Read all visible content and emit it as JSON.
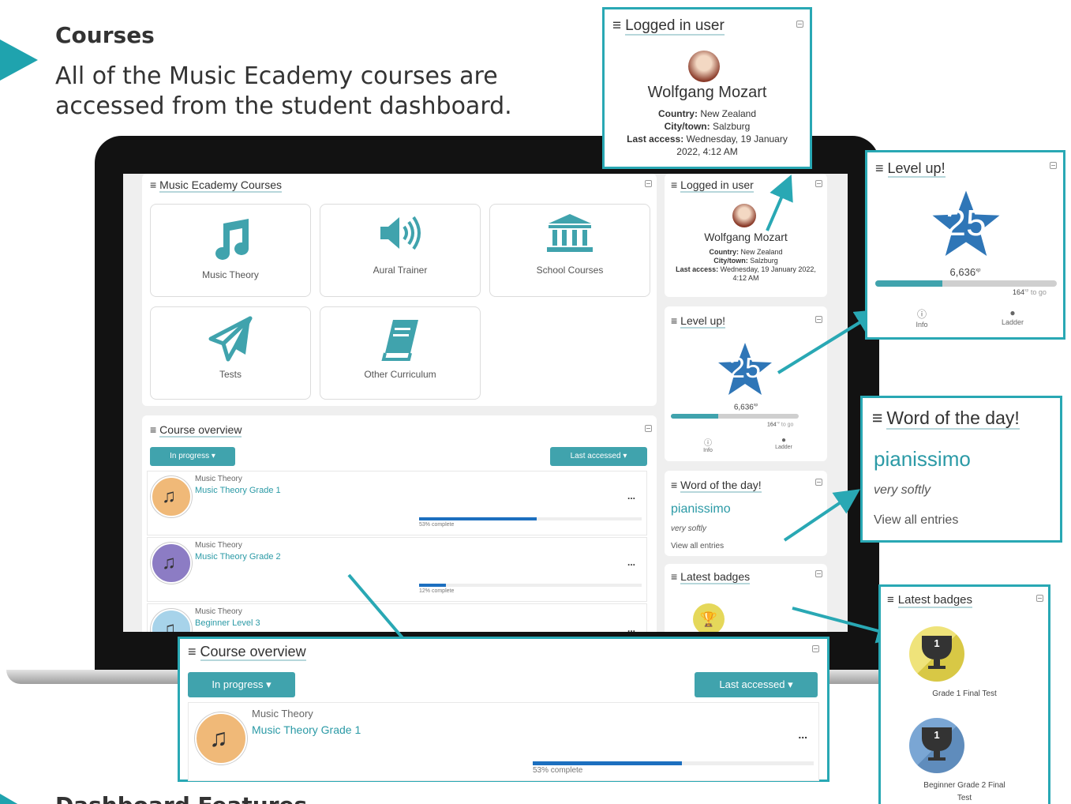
{
  "slide": {
    "title": "Courses",
    "description": "All of the Music Ecademy courses are accessed from the student dashboard.",
    "next_title": "Dashboard Features"
  },
  "courses_block": {
    "title": "Music Ecademy Courses",
    "tiles": [
      {
        "label": "Music Theory",
        "icon": "music-note-icon"
      },
      {
        "label": "Aural Trainer",
        "icon": "speaker-icon"
      },
      {
        "label": "School Courses",
        "icon": "building-icon"
      },
      {
        "label": "Tests",
        "icon": "paper-plane-icon"
      },
      {
        "label": "Other Curriculum",
        "icon": "book-icon"
      }
    ]
  },
  "course_overview": {
    "title": "Course overview",
    "filter_label": "In progress",
    "sort_label": "Last accessed",
    "courses": [
      {
        "category": "Music Theory",
        "name": "Music Theory Grade 1",
        "progress": 53,
        "progress_label": "53% complete",
        "color": "#f0b978"
      },
      {
        "category": "Music Theory",
        "name": "Music Theory Grade 2",
        "progress": 12,
        "progress_label": "12% complete",
        "color": "#8c7cc4"
      },
      {
        "category": "Music Theory",
        "name": "Beginner Level 3",
        "progress": 0,
        "progress_label": "",
        "color": "#a7d3ea"
      }
    ],
    "more_label": "..."
  },
  "logged_in_user": {
    "title": "Logged in user",
    "name": "Wolfgang Mozart",
    "country_label": "Country:",
    "country": "New Zealand",
    "city_label": "City/town:",
    "city": "Salzburg",
    "access_label": "Last access:",
    "access": "Wednesday, 19 January 2022, 4:12 AM"
  },
  "level_up": {
    "title": "Level up!",
    "level": "25",
    "xp": "6,636",
    "xp_suffix": "xp",
    "to_go": "164",
    "to_go_suffix": "xp",
    "to_go_label": "to go",
    "progress": 0.37,
    "info_label": "Info",
    "ladder_label": "Ladder"
  },
  "word_of_day": {
    "title": "Word of the day!",
    "word": "pianissimo",
    "definition": "very softly",
    "link": "View all entries"
  },
  "latest_badges": {
    "title": "Latest badges",
    "badges": [
      {
        "label": "Grade 1 Final Test",
        "number": "1",
        "color": "#e5d85a"
      },
      {
        "label": "Beginner Grade 2 Final Test",
        "number": "1",
        "color": "#6d9ac8"
      }
    ]
  },
  "colors": {
    "accent": "#29a8b4",
    "teal_button": "#40a3ad",
    "star": "#2f76b7",
    "progress_fill": "#1c6fbf"
  }
}
